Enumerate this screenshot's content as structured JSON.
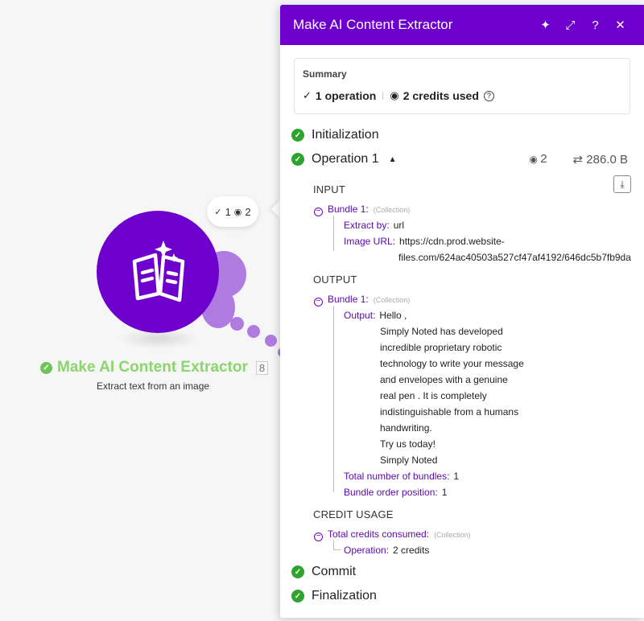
{
  "module": {
    "name": "Make AI Content Extractor",
    "subtitle": "Extract text from an image",
    "badge": "8",
    "bubble_ops": "1",
    "bubble_credits": "2",
    "color": "#6d00cc"
  },
  "panel": {
    "title": "Make AI Content Extractor",
    "header_buttons": {
      "ai": "✦",
      "expand": "⤢",
      "help": "?",
      "close": "✕"
    },
    "summary": {
      "label": "Summary",
      "operations": "1 operation",
      "credits": "2 credits used"
    },
    "phases": {
      "initialization": "Initialization",
      "operation": "Operation 1",
      "operation_credits": "2",
      "operation_size": "286.0 B",
      "commit": "Commit",
      "finalization": "Finalization"
    },
    "input": {
      "heading": "INPUT",
      "bundle_label": "Bundle 1:",
      "collection_tag": "(Collection)",
      "extract_by_key": "Extract by:",
      "extract_by_value": "url",
      "image_url_key": "Image URL:",
      "image_url_line1": "https://cdn.prod.website-",
      "image_url_line2": "files.com/624ac40503a527cf47af4192/646dc5b7fb9da"
    },
    "output": {
      "heading": "OUTPUT",
      "bundle_label": "Bundle 1:",
      "collection_tag": "(Collection)",
      "output_key": "Output:",
      "output_lines": [
        "Hello ,",
        "Simply Noted has developed",
        "incredible proprietary robotic",
        "technology to write your message",
        "and envelopes with a genuine",
        "real pen . It is completely",
        "indistinguishable from a humans",
        "handwriting.",
        "Try us today!",
        "Simply Noted"
      ],
      "total_bundles_key": "Total number of bundles:",
      "total_bundles_value": "1",
      "bundle_order_key": "Bundle order position:",
      "bundle_order_value": "1"
    },
    "credit_usage": {
      "heading": "CREDIT USAGE",
      "total_key": "Total credits consumed:",
      "collection_tag": "(Collection)",
      "operation_key": "Operation:",
      "operation_value": "2 credits"
    }
  }
}
